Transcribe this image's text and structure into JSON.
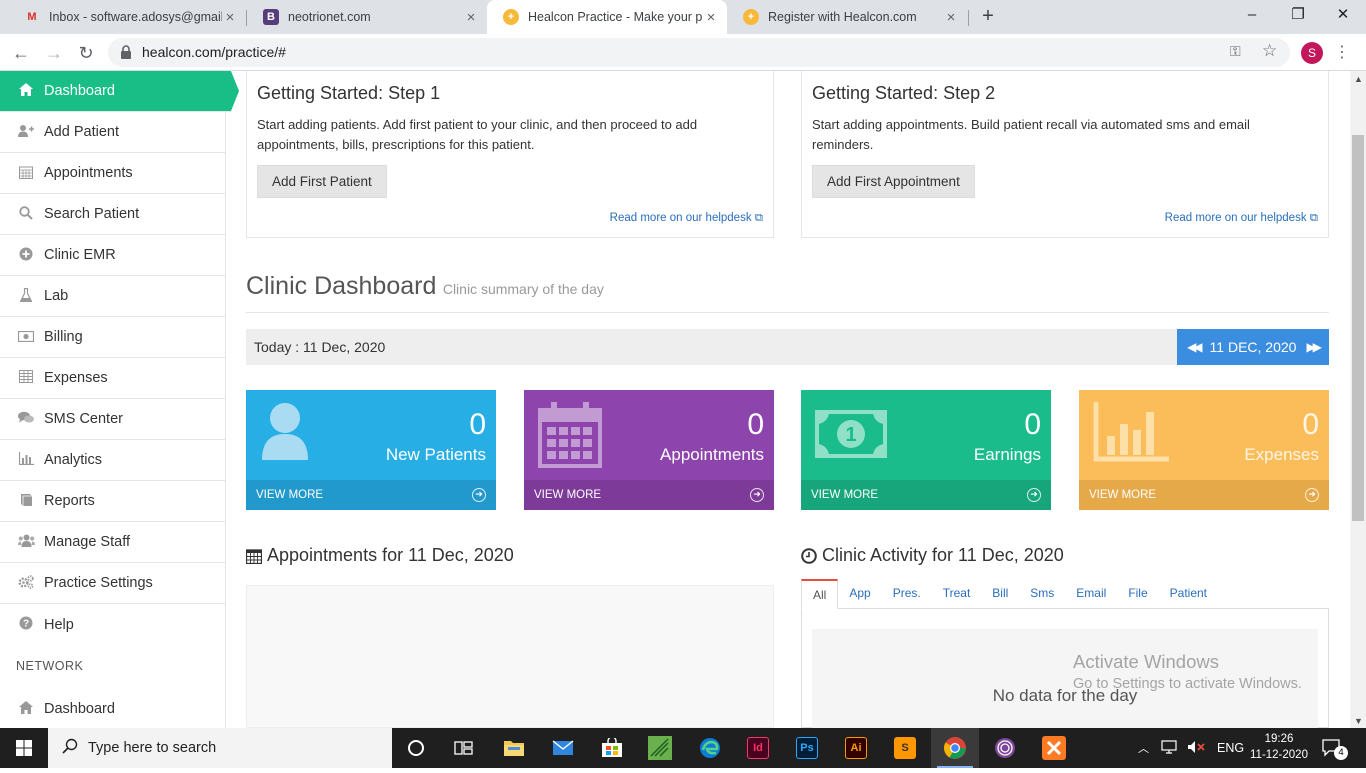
{
  "browser": {
    "tabs": [
      {
        "title": "Inbox - software.adosys@gmail.com",
        "favicon": "gmail-icon",
        "favicon_label": "M",
        "color": "#d93025"
      },
      {
        "title": "neotrionet.com",
        "favicon": "bootstrap-icon",
        "favicon_label": "B",
        "color": "#563d7c"
      },
      {
        "title": "Healcon Practice - Make your practice",
        "favicon": "healcon-icon",
        "favicon_label": "+",
        "color": "#f6b93b"
      },
      {
        "title": "Register with Healcon.com",
        "favicon": "healcon-icon",
        "favicon_label": "+",
        "color": "#f6b93b"
      }
    ],
    "new_tab_label": "+",
    "url": "healcon.com/practice/#",
    "profile_initial": "S"
  },
  "sidebar": {
    "items": [
      {
        "label": "Dashboard",
        "icon": "home-icon",
        "glyph": "⌂"
      },
      {
        "label": "Add Patient",
        "icon": "user-add-icon",
        "glyph": "👥"
      },
      {
        "label": "Appointments",
        "icon": "calendar-icon",
        "glyph": "▦"
      },
      {
        "label": "Search Patient",
        "icon": "search-icon",
        "glyph": "⚲"
      },
      {
        "label": "Clinic EMR",
        "icon": "plus-circle-icon",
        "glyph": "⊕"
      },
      {
        "label": "Lab",
        "icon": "flask-icon",
        "glyph": "⚗"
      },
      {
        "label": "Billing",
        "icon": "money-icon",
        "glyph": "▭"
      },
      {
        "label": "Expenses",
        "icon": "table-icon",
        "glyph": "▤"
      },
      {
        "label": "SMS Center",
        "icon": "comments-icon",
        "glyph": "💬"
      },
      {
        "label": "Analytics",
        "icon": "bar-chart-icon",
        "glyph": "▥"
      },
      {
        "label": "Reports",
        "icon": "book-icon",
        "glyph": "▬"
      },
      {
        "label": "Manage Staff",
        "icon": "users-icon",
        "glyph": "👥"
      },
      {
        "label": "Practice Settings",
        "icon": "cogs-icon",
        "glyph": "⚙"
      },
      {
        "label": "Help",
        "icon": "question-circle-icon",
        "glyph": "?"
      }
    ],
    "section_label": "NETWORK",
    "network_items": [
      {
        "label": "Dashboard",
        "icon": "home-icon",
        "glyph": "⌂"
      }
    ]
  },
  "getting_started": [
    {
      "title": "Getting Started: Step 1",
      "text": "Start adding patients. Add first patient to your clinic, and then proceed to add appointments, bills, prescriptions for this patient.",
      "button": "Add First Patient",
      "link": "Read more on our helpdesk"
    },
    {
      "title": "Getting Started: Step 2",
      "text": "Start adding appointments. Build patient recall via automated sms and email reminders.",
      "button": "Add First Appointment",
      "link": "Read more on our helpdesk"
    }
  ],
  "clinic_dashboard": {
    "title": "Clinic Dashboard",
    "subtitle": "Clinic summary of the day",
    "today_label": "Today : 11 Dec, 2020",
    "date_nav_label": "11 DEC, 2020"
  },
  "stats": [
    {
      "value": "0",
      "label": "New Patients",
      "footer": "VIEW MORE",
      "color": "#27aee4",
      "foot_color": "#2299cc",
      "icon": "user-icon"
    },
    {
      "value": "0",
      "label": "Appointments",
      "footer": "VIEW MORE",
      "color": "#8e44ad",
      "foot_color": "#7d3a99",
      "icon": "calendar-icon"
    },
    {
      "value": "0",
      "label": "Earnings",
      "footer": "VIEW MORE",
      "color": "#1abc8c",
      "foot_color": "#17a57b",
      "icon": "money-icon"
    },
    {
      "value": "0",
      "label": "Expenses",
      "footer": "VIEW MORE",
      "color": "#fbbd5a",
      "foot_color": "#e5a94a",
      "icon": "bar-chart-icon"
    }
  ],
  "appointments_section": {
    "title": "Appointments for 11 Dec, 2020"
  },
  "activity_section": {
    "title": "Clinic Activity for 11 Dec, 2020",
    "tabs": [
      "All",
      "App",
      "Pres.",
      "Treat",
      "Bill",
      "Sms",
      "Email",
      "File",
      "Patient"
    ],
    "empty_text": "No data for the day"
  },
  "watermark": {
    "line1": "Activate Windows",
    "line2": "Go to Settings to activate Windows."
  },
  "taskbar": {
    "search_placeholder": "Type here to search",
    "language": "ENG",
    "time": "19:26",
    "date": "11-12-2020",
    "notification_count": "4"
  }
}
